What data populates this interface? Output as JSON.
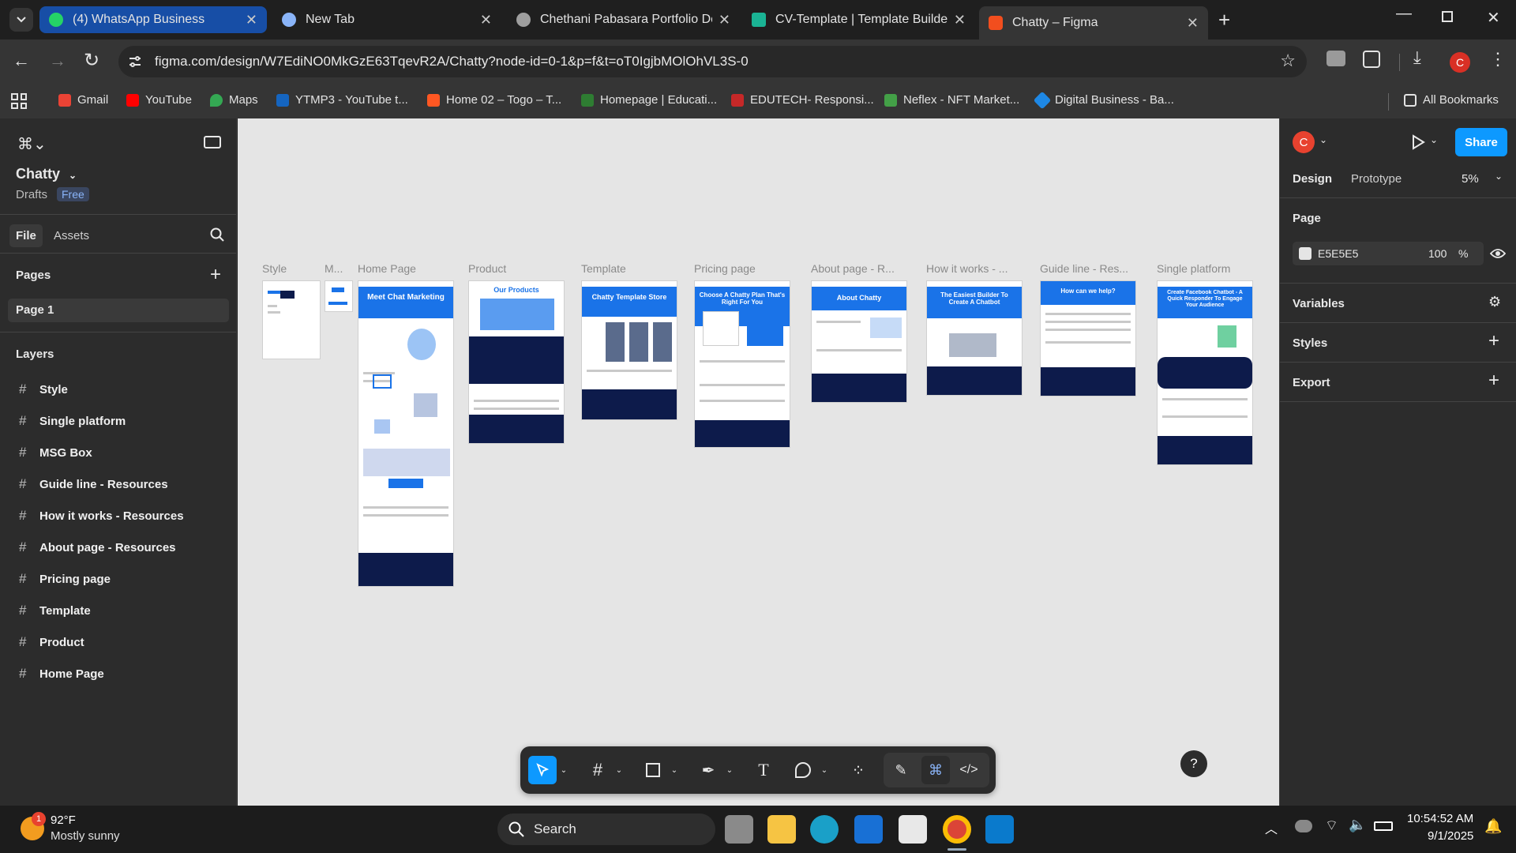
{
  "browser": {
    "tabs": [
      {
        "title": "(4) WhatsApp Business",
        "color": "#25d366"
      },
      {
        "title": "New Tab",
        "color": "#8ab4f8"
      },
      {
        "title": "Chethani Pabasara Portfolio De",
        "color": "#9e9e9e"
      },
      {
        "title": "CV-Template | Template Builder",
        "color": "#1ab394"
      },
      {
        "title": "Chatty – Figma",
        "color": "#f24e1e"
      }
    ],
    "url": "figma.com/design/W7EdiNO0MkGzE63TqevR2A/Chatty?node-id=0-1&p=f&t=oT0IgjbMOlOhVL3S-0",
    "bookmarks": [
      {
        "label": "Gmail",
        "color": "#ea4335"
      },
      {
        "label": "YouTube",
        "color": "#ff0000"
      },
      {
        "label": "Maps",
        "color": "#34a853"
      },
      {
        "label": "YTMP3 - YouTube t...",
        "color": "#1565c0"
      },
      {
        "label": "Home 02 – Togo – T...",
        "color": "#ff5722"
      },
      {
        "label": "Homepage | Educati...",
        "color": "#2e7d32"
      },
      {
        "label": "EDUTECH- Responsi...",
        "color": "#c62828"
      },
      {
        "label": "Neflex - NFT Market...",
        "color": "#43a047"
      },
      {
        "label": "Digital Business - Ba...",
        "color": "#1e88e5"
      }
    ],
    "all_bookmarks": "All Bookmarks",
    "profile_initial": "C"
  },
  "figma": {
    "file_name": "Chatty",
    "drafts": "Drafts",
    "plan": "Free",
    "tab_file": "File",
    "tab_assets": "Assets",
    "pages_heading": "Pages",
    "current_page": "Page 1",
    "layers_heading": "Layers",
    "layers": [
      "Style",
      "Single platform",
      "MSG Box",
      "Guide line - Resources",
      "How it works - Resources",
      "About page - Resources",
      "Pricing page",
      "Template",
      "Product",
      "Home Page"
    ],
    "frames": [
      "Style",
      "M...",
      "Home Page",
      "Product",
      "Template",
      "Pricing page",
      "About page - R...",
      "How it works - ...",
      "Guide line - Res...",
      "Single platform"
    ],
    "frame_heads": [
      "Meet Chat Marketing",
      "Our Products",
      "Chatty Template Store",
      "Choose A Chatty Plan That's Right For You",
      "About Chatty",
      "The Easiest Builder To Create A Chatbot",
      "How can we help?",
      "Create Facebook Chatbot - A Quick Responder To Engage Your Audience"
    ],
    "right": {
      "design": "Design",
      "prototype": "Prototype",
      "zoom": "5%",
      "share": "Share",
      "page_heading": "Page",
      "bg_hex": "E5E5E5",
      "bg_opacity": "100",
      "pct": "%",
      "variables": "Variables",
      "styles": "Styles",
      "export": "Export"
    }
  },
  "taskbar": {
    "temp": "92°F",
    "weather": "Mostly sunny",
    "search": "Search",
    "time": "10:54:52 AM",
    "date": "9/1/2025",
    "badge": "1"
  }
}
